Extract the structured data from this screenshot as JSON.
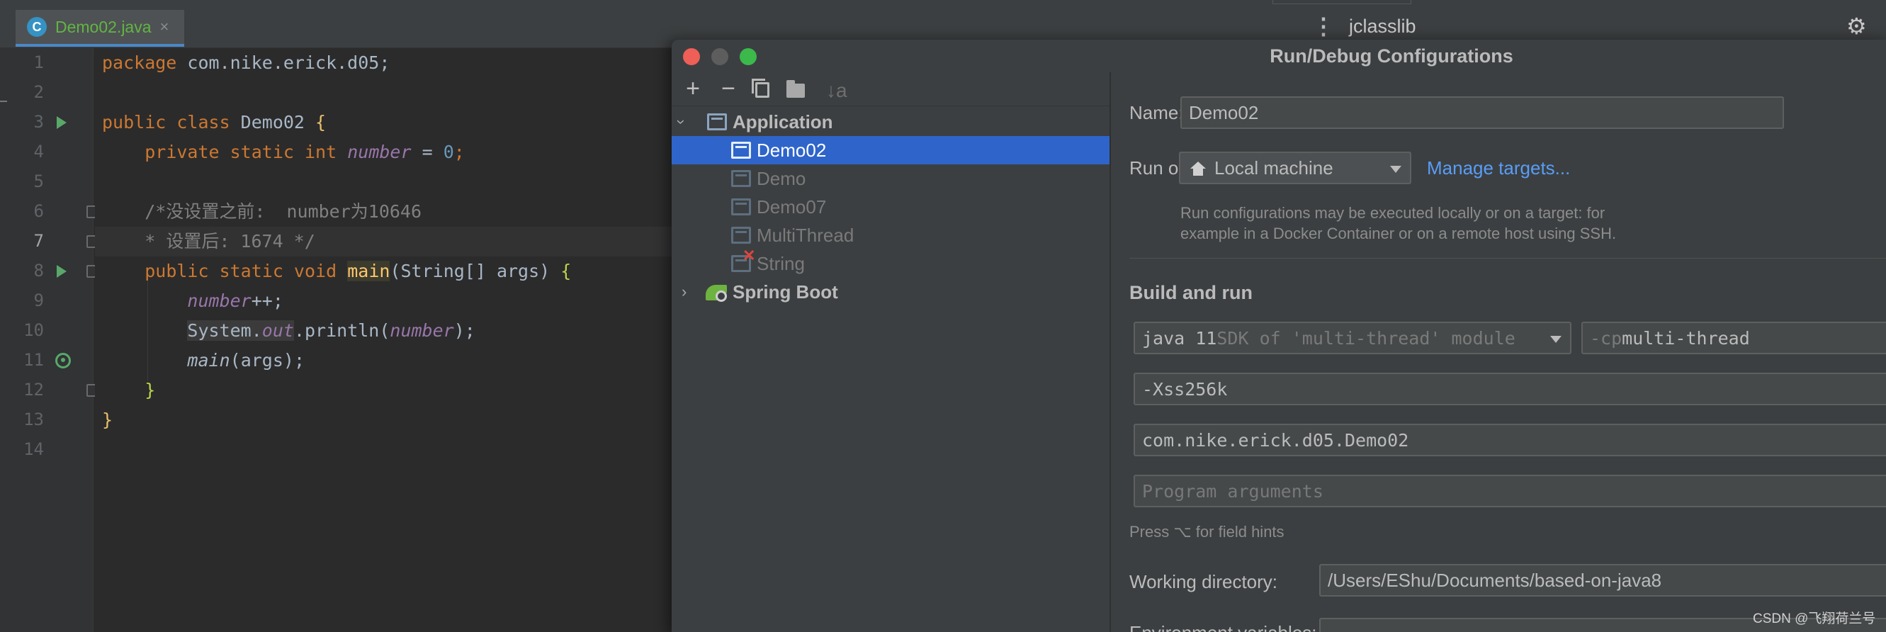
{
  "editor": {
    "tab": {
      "icon": "java-class-icon",
      "icon_letter": "C",
      "label": "Demo02.java",
      "close": "×"
    },
    "right_panel_title": "jclasslib",
    "lines": [
      {
        "n": "1"
      },
      {
        "n": "2"
      },
      {
        "n": "3"
      },
      {
        "n": "4"
      },
      {
        "n": "5"
      },
      {
        "n": "6"
      },
      {
        "n": "7"
      },
      {
        "n": "8"
      },
      {
        "n": "9"
      },
      {
        "n": "10"
      },
      {
        "n": "11"
      },
      {
        "n": "12"
      },
      {
        "n": "13"
      },
      {
        "n": "14"
      }
    ],
    "code": {
      "l1_kw": "package",
      "l1_rest": " com.nike.erick.d05;",
      "l3_kw": "public class",
      "l3_name": " Demo02 ",
      "l3_brace": "{",
      "l4_kw": "private static int",
      "l4_field": "number",
      "l4_eq": " = ",
      "l4_num": "0",
      "l4_semi": ";",
      "l6_comment": "/*没设置之前:  number为10646",
      "l7_comment": "* 设置后: 1674 */",
      "l8_kw": "public static void",
      "l8_method": "main",
      "l8_params": "(String[] args) ",
      "l8_brace": "{",
      "l9_field": "number",
      "l9_rest": "++;",
      "l10_sys": "System.",
      "l10_out": "out",
      "l10_call": ".println(",
      "l10_field": "number",
      "l10_end": ");",
      "l11_method": "main",
      "l11_rest": "(args);",
      "l12_brace": "}",
      "l13_brace": "}"
    }
  },
  "dialog": {
    "title": "Run/Debug Configurations",
    "toolbar": {
      "add": "+",
      "remove": "−",
      "sort": "↓a"
    },
    "tree": {
      "application": "Application",
      "items": [
        "Demo02",
        "Demo",
        "Demo07",
        "MultiThread",
        "String"
      ],
      "spring_boot": "Spring Boot"
    },
    "form": {
      "name_label": "Name:",
      "name_value": "Demo02",
      "run_on_label": "Run on:",
      "run_on_value": "Local machine",
      "manage_targets": "Manage targets...",
      "run_on_hint_1": "Run configurations may be executed locally or on a target: for",
      "run_on_hint_2": "example in a Docker Container or on a remote host using SSH.",
      "build_and_run": "Build and run",
      "sdk_version": "java 11",
      "sdk_desc": " SDK of 'multi-thread' module",
      "cp_flag": "-cp",
      "cp_value": " multi-thread",
      "vm_options": "-Xss256k",
      "main_class": "com.nike.erick.d05.Demo02",
      "program_args_placeholder": "Program arguments",
      "field_hint": "Press ⌥ for field hints",
      "working_dir_label": "Working directory:",
      "working_dir_value": "/Users/EShu/Documents/based-on-java8",
      "env_vars_label": "Environment variables:"
    }
  },
  "watermark": "CSDN @飞翔荷兰号",
  "colors": {
    "accent": "#2f65ca",
    "link": "#589df6",
    "run_green": "#59a869"
  }
}
